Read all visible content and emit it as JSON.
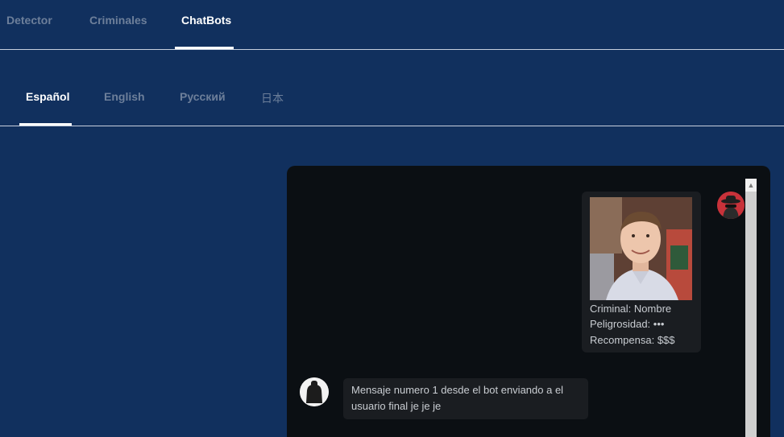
{
  "nav": {
    "tabs": [
      {
        "label": "Detector"
      },
      {
        "label": "Criminales"
      },
      {
        "label": "ChatBots"
      }
    ],
    "active_tab": "ChatBots"
  },
  "languages": {
    "tabs": [
      {
        "label": "Español"
      },
      {
        "label": "English"
      },
      {
        "label": "Русский"
      },
      {
        "label": "日本"
      }
    ],
    "active_tab": "Español"
  },
  "chat": {
    "criminal_card": {
      "criminal": "Criminal: Nombre",
      "danger": "Peligrosidad: •••",
      "reward": "Recompensa: $$$"
    },
    "messages": [
      {
        "sender": "bot",
        "text": "Mensaje numero 1 desde el bot enviando a el usuario final je je je"
      }
    ]
  },
  "colors": {
    "background": "#11305e",
    "panel": "#0b0f13",
    "bubble": "#1a1d21",
    "accent_active": "#ffffff",
    "inactive_text": "#6d7f9a",
    "bot_avatar": "#c8323a"
  }
}
